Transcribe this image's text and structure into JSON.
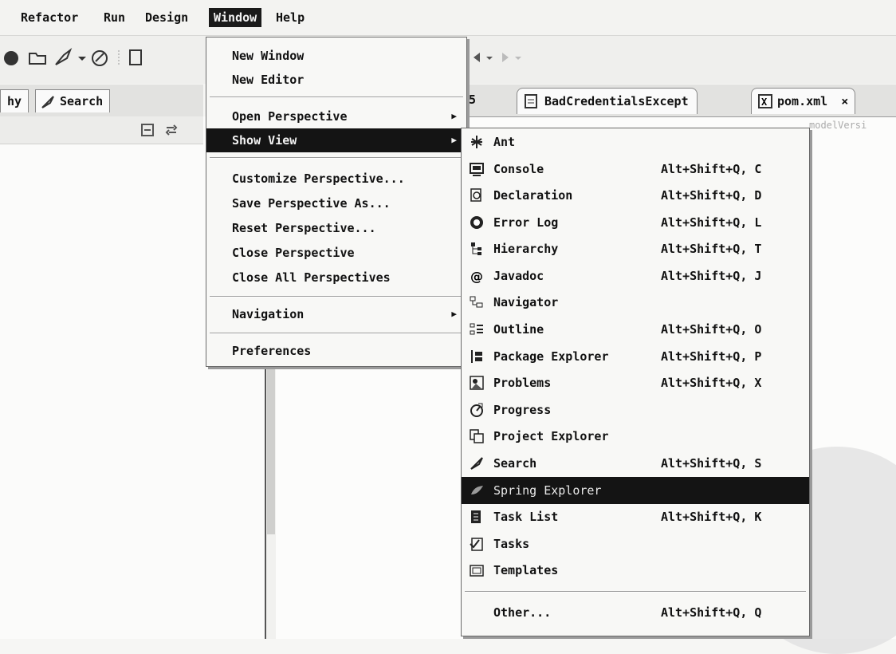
{
  "menubar": {
    "items": [
      "Refactor",
      "Run",
      "Design",
      "Window",
      "Help"
    ]
  },
  "view_tabs": {
    "left_partial": "hy",
    "search": "Search"
  },
  "editor_tabs": {
    "partial_number": "5",
    "tab1": "BadCredentialsExcept",
    "tab2": "pom.xml"
  },
  "editor": {
    "text": "modelVersi"
  },
  "window_menu": {
    "new_window": "New Window",
    "new_editor": "New Editor",
    "open_perspective": "Open Perspective",
    "show_view": "Show View",
    "customize_perspective": "Customize Perspective...",
    "save_perspective_as": "Save Perspective As...",
    "reset_perspective": "Reset Perspective...",
    "close_perspective": "Close Perspective",
    "close_all_perspectives": "Close All Perspectives",
    "navigation": "Navigation",
    "preferences": "Preferences"
  },
  "show_view_menu": {
    "items": [
      {
        "label": "Ant",
        "shortcut": "",
        "icon": "ant-icon"
      },
      {
        "label": "Console",
        "shortcut": "Alt+Shift+Q, C",
        "icon": "console-icon"
      },
      {
        "label": "Declaration",
        "shortcut": "Alt+Shift+Q, D",
        "icon": "declaration-icon"
      },
      {
        "label": "Error Log",
        "shortcut": "Alt+Shift+Q, L",
        "icon": "error-log-icon"
      },
      {
        "label": "Hierarchy",
        "shortcut": "Alt+Shift+Q, T",
        "icon": "hierarchy-icon"
      },
      {
        "label": "Javadoc",
        "shortcut": "Alt+Shift+Q, J",
        "icon": "javadoc-icon"
      },
      {
        "label": "Navigator",
        "shortcut": "",
        "icon": "navigator-icon"
      },
      {
        "label": "Outline",
        "shortcut": "Alt+Shift+Q, O",
        "icon": "outline-icon"
      },
      {
        "label": "Package Explorer",
        "shortcut": "Alt+Shift+Q, P",
        "icon": "package-explorer-icon"
      },
      {
        "label": "Problems",
        "shortcut": "Alt+Shift+Q, X",
        "icon": "problems-icon"
      },
      {
        "label": "Progress",
        "shortcut": "",
        "icon": "progress-icon"
      },
      {
        "label": "Project Explorer",
        "shortcut": "",
        "icon": "project-explorer-icon"
      },
      {
        "label": "Search",
        "shortcut": "Alt+Shift+Q, S",
        "icon": "search-icon"
      },
      {
        "label": "Spring Explorer",
        "shortcut": "",
        "icon": "spring-explorer-icon"
      },
      {
        "label": "Task List",
        "shortcut": "Alt+Shift+Q, K",
        "icon": "task-list-icon"
      },
      {
        "label": "Tasks",
        "shortcut": "",
        "icon": "tasks-icon"
      },
      {
        "label": "Templates",
        "shortcut": "",
        "icon": "templates-icon"
      },
      {
        "label": "Other...",
        "shortcut": "Alt+Shift+Q, Q",
        "icon": ""
      }
    ]
  }
}
